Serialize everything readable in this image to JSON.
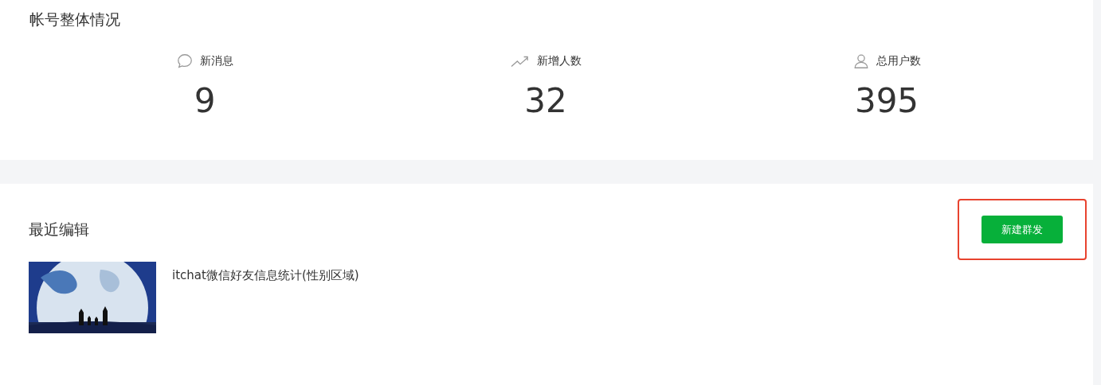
{
  "overview": {
    "title": "帐号整体情况",
    "stats": [
      {
        "kind": "message",
        "label": "新消息",
        "value": "9"
      },
      {
        "kind": "trend",
        "label": "新增人数",
        "value": "32"
      },
      {
        "kind": "user",
        "label": "总用户数",
        "value": "395"
      }
    ]
  },
  "recent": {
    "title": "最近编辑",
    "new_button": {
      "label": "新建群发",
      "highlighted": true
    },
    "items": [
      {
        "title": "itchat微信好友信息统计(性别区域)"
      }
    ]
  }
}
